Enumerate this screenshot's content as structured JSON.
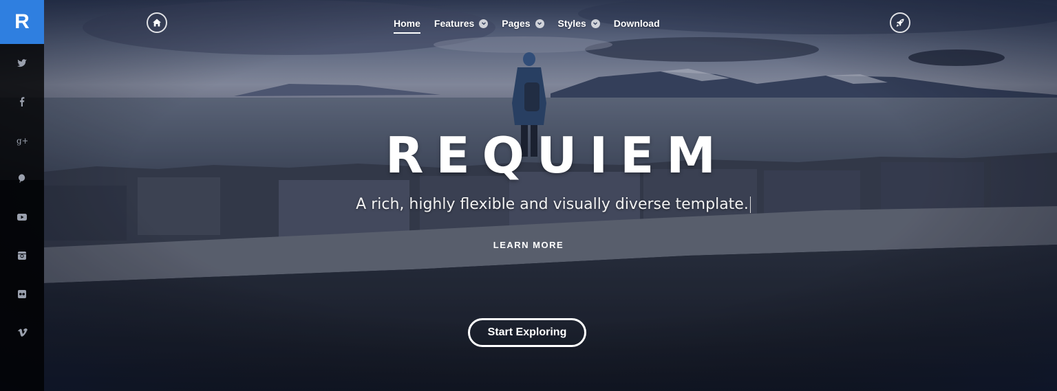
{
  "brand": {
    "letter": "R",
    "color": "#2f7fe0"
  },
  "sidebar": {
    "social": [
      {
        "name": "twitter-icon"
      },
      {
        "name": "facebook-icon"
      },
      {
        "name": "google-plus-icon"
      },
      {
        "name": "pinterest-icon"
      },
      {
        "name": "youtube-icon"
      },
      {
        "name": "instagram-icon"
      },
      {
        "name": "flickr-icon"
      },
      {
        "name": "vimeo-icon"
      }
    ]
  },
  "nav": {
    "home_icon": "home-icon",
    "rocket_icon": "rocket-icon",
    "items": [
      {
        "label": "Home",
        "active": true,
        "dropdown": false
      },
      {
        "label": "Features",
        "active": false,
        "dropdown": true
      },
      {
        "label": "Pages",
        "active": false,
        "dropdown": true
      },
      {
        "label": "Styles",
        "active": false,
        "dropdown": true
      },
      {
        "label": "Download",
        "active": false,
        "dropdown": false
      }
    ]
  },
  "hero": {
    "title": "REQUIEM",
    "subtitle": "A rich, highly flexible and visually diverse template.",
    "learn_more": "LEARN MORE",
    "cta": "Start Exploring"
  }
}
